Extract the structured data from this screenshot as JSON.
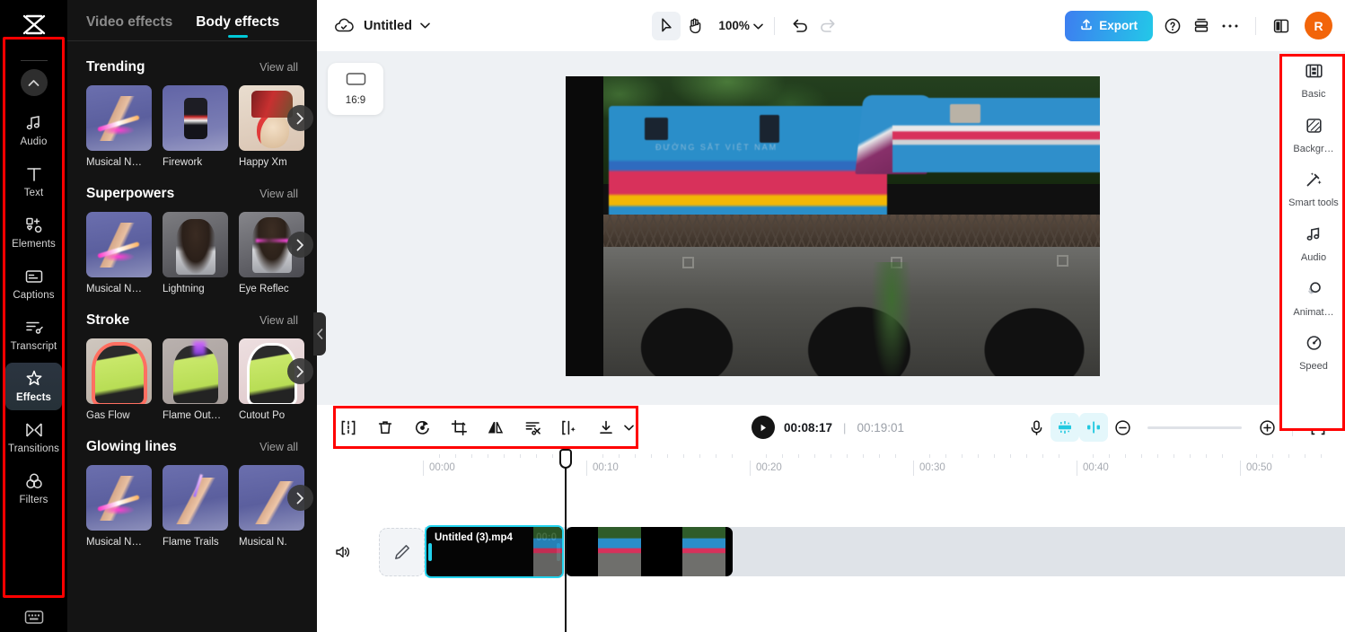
{
  "app": {
    "logo_icon": "capcut-logo-icon"
  },
  "left_rail": {
    "collapse_icon": "chevron-up-icon",
    "items": [
      {
        "label": "Audio",
        "icon": "music-note-icon",
        "active": false
      },
      {
        "label": "Text",
        "icon": "text-t-icon",
        "active": false
      },
      {
        "label": "Elements",
        "icon": "elements-icon",
        "active": false
      },
      {
        "label": "Captions",
        "icon": "captions-icon",
        "active": false
      },
      {
        "label": "Transcript",
        "icon": "transcript-icon",
        "active": false
      },
      {
        "label": "Effects",
        "icon": "sparkle-star-icon",
        "active": true
      },
      {
        "label": "Transitions",
        "icon": "transitions-icon",
        "active": false
      },
      {
        "label": "Filters",
        "icon": "filters-circles-icon",
        "active": false
      }
    ],
    "keyboard_icon": "keyboard-shortcuts-icon"
  },
  "effects_panel": {
    "tabs": [
      {
        "label": "Video effects",
        "active": false
      },
      {
        "label": "Body effects",
        "active": true
      }
    ],
    "view_all_label": "View all",
    "next_arrow_icon": "chevron-right-icon",
    "sections": [
      {
        "title": "Trending",
        "items": [
          {
            "label": "Musical N…",
            "thumb": "th-arm"
          },
          {
            "label": "Firework",
            "thumb": "th-fire"
          },
          {
            "label": "Happy Xm",
            "thumb": "th-xmas"
          }
        ]
      },
      {
        "title": "Superpowers",
        "items": [
          {
            "label": "Musical N…",
            "thumb": "th-arm"
          },
          {
            "label": "Lightning",
            "thumb": "th-light"
          },
          {
            "label": "Eye Reflec",
            "thumb": "th-eye"
          }
        ]
      },
      {
        "title": "Stroke",
        "items": [
          {
            "label": "Gas Flow",
            "thumb": "th-gas"
          },
          {
            "label": "Flame Out…",
            "thumb": "th-flameout"
          },
          {
            "label": "Cutout Po",
            "thumb": "th-cut"
          }
        ]
      },
      {
        "title": "Glowing lines",
        "items": [
          {
            "label": "Musical N…",
            "thumb": "th-arm"
          },
          {
            "label": "Flame Trails",
            "thumb": "th-trail"
          },
          {
            "label": "Musical N.",
            "thumb": "th-hand"
          }
        ]
      }
    ],
    "collapse_icon": "chevron-left-icon"
  },
  "topbar": {
    "cloud_icon": "cloud-save-icon",
    "title": "Untitled",
    "title_chevron_icon": "chevron-down-icon",
    "select_tool_icon": "cursor-arrow-icon",
    "hand_tool_icon": "hand-pan-icon",
    "zoom_value": "100%",
    "zoom_chevron_icon": "chevron-down-icon",
    "undo_icon": "undo-arrow-icon",
    "redo_icon": "redo-arrow-icon",
    "export_label": "Export",
    "export_icon": "upload-icon",
    "export_color": "#3d7ef0",
    "help_icon": "question-circle-icon",
    "layers_icon": "stack-layers-icon",
    "more_icon": "ellipsis-icon",
    "split_view_icon": "split-panel-icon",
    "avatar_initial": "R",
    "avatar_color": "#f2650a"
  },
  "stage": {
    "ratio_label": "16:9",
    "ratio_icon": "aspect-ratio-icon",
    "video_overlay_text": "ĐƯỜNG SẮT VIỆT NAM"
  },
  "right_panel": {
    "items": [
      {
        "label": "Basic",
        "icon": "film-strip-icon"
      },
      {
        "label": "Backgr…",
        "icon": "background-hatch-icon"
      },
      {
        "label": "Smart tools",
        "icon": "magic-wand-icon"
      },
      {
        "label": "Audio",
        "icon": "music-note-icon"
      },
      {
        "label": "Animat…",
        "icon": "animation-circles-icon"
      },
      {
        "label": "Speed",
        "icon": "speedometer-icon"
      }
    ]
  },
  "timeline_toolbar": {
    "tools": [
      {
        "name": "split-clip-icon",
        "label": "Split"
      },
      {
        "name": "delete-trash-icon",
        "label": "Delete"
      },
      {
        "name": "rotate-icon",
        "label": "Rotate"
      },
      {
        "name": "crop-icon",
        "label": "Crop"
      },
      {
        "name": "mirror-flip-icon",
        "label": "Mirror"
      },
      {
        "name": "auto-cut-icon",
        "label": "Auto cut"
      },
      {
        "name": "freeze-frame-icon",
        "label": "Freeze"
      },
      {
        "name": "download-icon",
        "label": "Download"
      }
    ],
    "download_chevron_icon": "chevron-down-icon",
    "play_icon": "play-triangle-icon",
    "current_time": "00:08:17",
    "time_separator": "|",
    "total_time": "00:19:01",
    "mic_icon": "microphone-icon",
    "mix_icon": "audio-mixer-icon",
    "align_icon": "waveform-align-icon",
    "zoom_out_icon": "minus-circle-icon",
    "zoom_in_icon": "plus-circle-icon",
    "accent_color": "#22d3ee"
  },
  "timeline": {
    "ruler_labels": [
      "00:00",
      "00:10",
      "00:20",
      "00:30",
      "00:40",
      "00:50"
    ],
    "speaker_icon": "speaker-volume-icon",
    "edit_icon": "pencil-edit-icon",
    "clips": [
      {
        "name": "Untitled (3).mp4",
        "duration": "00:0",
        "selected": true
      },
      {
        "name": "",
        "duration": "",
        "selected": false
      }
    ]
  }
}
